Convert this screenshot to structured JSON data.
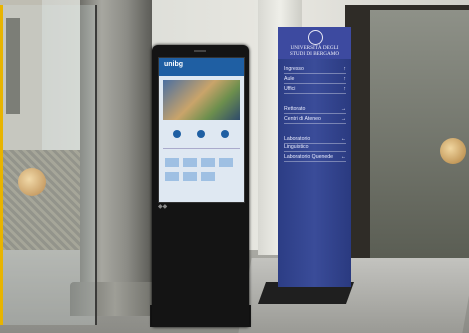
{
  "kiosk": {
    "screen_logo": "unibg"
  },
  "sign": {
    "title_line1": "UNIVERSITÀ DEGLI",
    "title_line2": "STUDI DI BERGAMO",
    "rows": [
      {
        "label": "Ingresso",
        "arrow": "↑"
      },
      {
        "label": "Aule",
        "arrow": "↑"
      },
      {
        "label": "Uffici",
        "arrow": "↑"
      },
      {
        "label": "Rettorato",
        "arrow": "→"
      },
      {
        "label": "Centri di Ateneo",
        "arrow": "→"
      },
      {
        "label": "Laboratorio",
        "arrow": "←"
      },
      {
        "label": "Linguistico",
        "arrow": ""
      },
      {
        "label": "Laboratorio Quenede",
        "arrow": "←"
      }
    ]
  },
  "colors": {
    "sign_blue": "#2c3d85",
    "kiosk_black": "#141414",
    "screen_blue": "#1f5fa3",
    "door_frame_yellow": "#e8b400"
  }
}
